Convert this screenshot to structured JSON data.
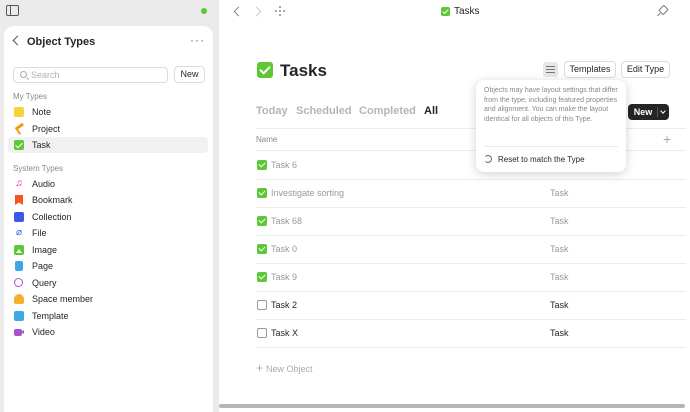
{
  "sidebar": {
    "title": "Object Types",
    "search_placeholder": "Search",
    "new_label": "New",
    "my_types_label": "My Types",
    "my_types": [
      {
        "label": "Note",
        "icon": "note-icon"
      },
      {
        "label": "Project",
        "icon": "hammer-icon"
      },
      {
        "label": "Task",
        "icon": "checkbox-icon"
      }
    ],
    "system_types_label": "System Types",
    "system_types": [
      {
        "label": "Audio",
        "icon": "music-note-icon"
      },
      {
        "label": "Bookmark",
        "icon": "bookmark-icon"
      },
      {
        "label": "Collection",
        "icon": "collection-icon"
      },
      {
        "label": "File",
        "icon": "paperclip-icon"
      },
      {
        "label": "Image",
        "icon": "image-icon"
      },
      {
        "label": "Page",
        "icon": "page-icon"
      },
      {
        "label": "Query",
        "icon": "query-icon"
      },
      {
        "label": "Space member",
        "icon": "person-icon"
      },
      {
        "label": "Template",
        "icon": "template-icon"
      },
      {
        "label": "Video",
        "icon": "video-icon"
      }
    ]
  },
  "header": {
    "title": "Tasks"
  },
  "page": {
    "title": "Tasks",
    "templates_label": "Templates",
    "edit_type_label": "Edit Type"
  },
  "tabs": [
    "Today",
    "Scheduled",
    "Completed",
    "All"
  ],
  "new_button_label": "New",
  "table": {
    "column_name": "Name",
    "rows": [
      {
        "name": "Task 6",
        "type": "",
        "done": true
      },
      {
        "name": "Investigate sorting",
        "type": "Task",
        "done": true
      },
      {
        "name": "Task 68",
        "type": "Task",
        "done": true
      },
      {
        "name": "Task 0",
        "type": "Task",
        "done": true
      },
      {
        "name": "Task 9",
        "type": "Task",
        "done": true
      },
      {
        "name": "Task 2",
        "type": "Task",
        "done": false
      },
      {
        "name": "Task X",
        "type": "Task",
        "done": false
      }
    ],
    "new_object_label": "New Object"
  },
  "popover": {
    "text": "Objects may have layout settings that differ from the type, including featured properties and alignment. You can make the layout identical for all objects of this Type.",
    "reset_label": "Reset to match the Type"
  },
  "colors": {
    "accent_green": "#5dc735",
    "sync_status": "#5dc735"
  }
}
